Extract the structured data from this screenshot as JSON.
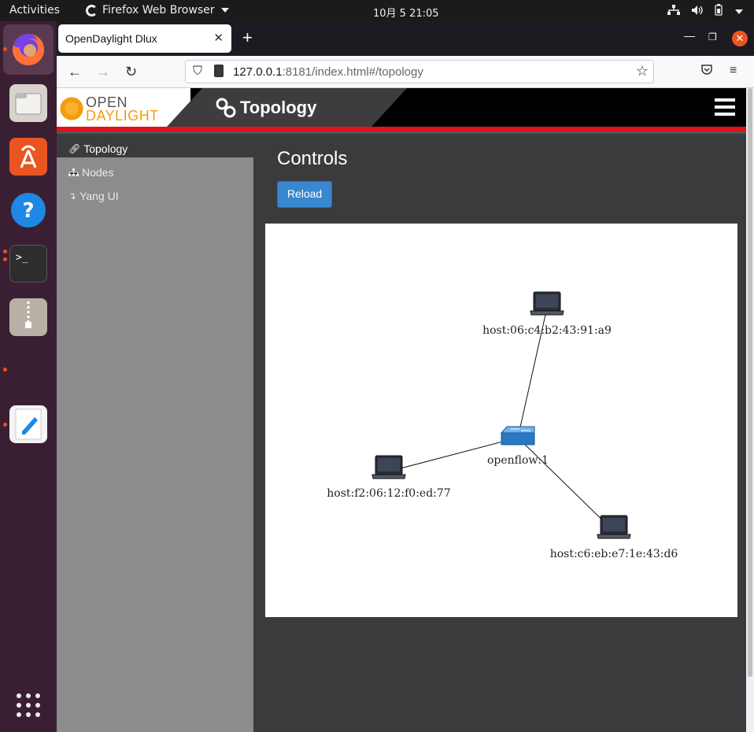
{
  "topbar": {
    "activities": "Activities",
    "app_name": "Firefox Web Browser",
    "clock": "10月 5  21:05"
  },
  "dock": {
    "apps": [
      "Firefox",
      "Files",
      "Ubuntu Software",
      "Help",
      "Terminal",
      "Archive Manager",
      "Text Editor",
      "Show Applications"
    ]
  },
  "browser": {
    "tab_title": "OpenDaylight Dlux",
    "url_host": "127.0.0.1",
    "url_rest": ":8181/index.html#/topology"
  },
  "dlux": {
    "logo_line1": "OPEN",
    "logo_line2": "DAYLIGHT",
    "header_title": "Topology",
    "sidebar": [
      {
        "label": "Topology",
        "icon": "link-icon",
        "active": true
      },
      {
        "label": "Nodes",
        "icon": "sitemap-icon",
        "active": false
      },
      {
        "label": "Yang UI",
        "icon": "level-down-icon",
        "active": false
      }
    ],
    "controls_title": "Controls",
    "reload_label": "Reload"
  },
  "topology": {
    "nodes": [
      {
        "id": "openflow:1",
        "type": "switch"
      },
      {
        "id": "host:06:c4:b2:43:91:a9",
        "type": "host"
      },
      {
        "id": "host:f2:06:12:f0:ed:77",
        "type": "host"
      },
      {
        "id": "host:c6:eb:e7:1e:43:d6",
        "type": "host"
      }
    ],
    "links": [
      [
        "openflow:1",
        "host:06:c4:b2:43:91:a9"
      ],
      [
        "openflow:1",
        "host:f2:06:12:f0:ed:77"
      ],
      [
        "openflow:1",
        "host:c6:eb:e7:1e:43:d6"
      ]
    ]
  }
}
